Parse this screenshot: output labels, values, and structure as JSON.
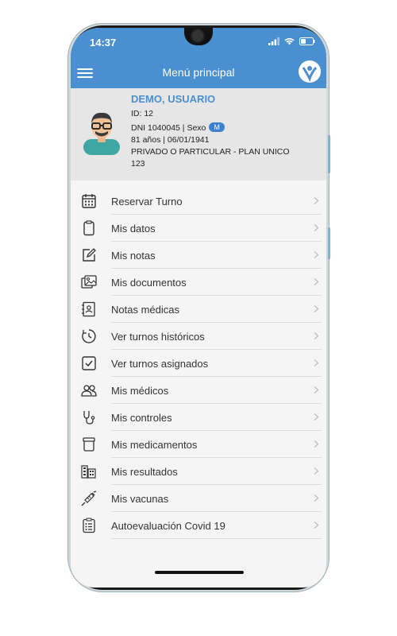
{
  "status_bar": {
    "time": "14:37"
  },
  "header": {
    "title": "Menú principal"
  },
  "profile": {
    "name": "DEMO, USUARIO",
    "id_line": "ID: 12",
    "dni_sex_line": "DNI 1040045 | Sexo",
    "sex": "M",
    "age_dob_line": "81 años | 06/01/1941",
    "plan_line": "PRIVADO O PARTICULAR - PLAN UNICO",
    "plan_number": "123"
  },
  "menu": {
    "items": [
      {
        "label": "Reservar Turno",
        "icon": "calendar-icon"
      },
      {
        "label": "Mis datos",
        "icon": "clipboard-icon"
      },
      {
        "label": "Mis notas",
        "icon": "edit-note-icon"
      },
      {
        "label": "Mis documentos",
        "icon": "image-documents-icon"
      },
      {
        "label": "Notas médicas",
        "icon": "medical-notes-icon"
      },
      {
        "label": "Ver turnos históricos",
        "icon": "history-clock-icon"
      },
      {
        "label": "Ver turnos asignados",
        "icon": "checkbox-icon"
      },
      {
        "label": "Mis médicos",
        "icon": "people-icon"
      },
      {
        "label": "Mis controles",
        "icon": "stethoscope-icon"
      },
      {
        "label": "Mis medicamentos",
        "icon": "medicine-jar-icon"
      },
      {
        "label": "Mis resultados",
        "icon": "results-icon"
      },
      {
        "label": "Mis vacunas",
        "icon": "syringe-icon"
      },
      {
        "label": "Autoevaluación Covid 19",
        "icon": "checklist-icon"
      }
    ]
  },
  "colors": {
    "header": "#4a8fd0",
    "profile_bg": "#e6e6e6",
    "name": "#4a8fd0"
  }
}
